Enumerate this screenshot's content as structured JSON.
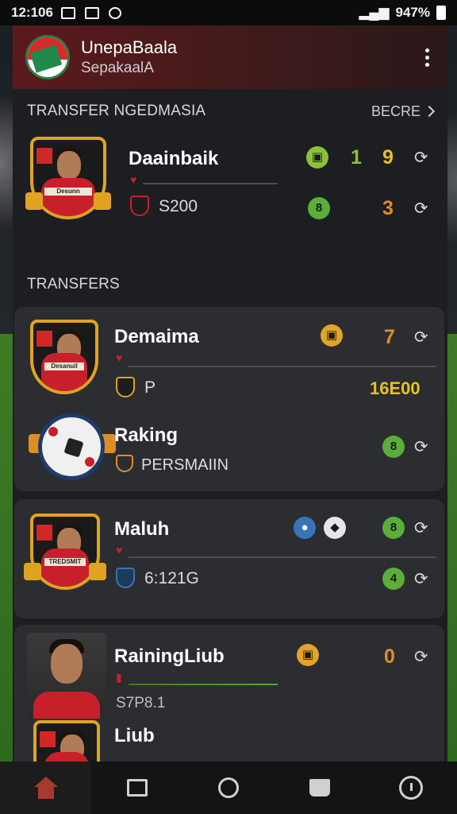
{
  "status_bar": {
    "time": "12:106",
    "battery": "947%"
  },
  "header": {
    "title": "UnepaBaala",
    "subtitle": "SepakaalA"
  },
  "featured": {
    "section_title": "TRANSFER NGEDMASIA",
    "more_label": "BECRE",
    "player": {
      "name": "Daainbaik",
      "sub_value": "S200",
      "score_a": "1",
      "score_b": "9",
      "score_c": "3",
      "crest_text": "Desunn"
    }
  },
  "transfers": {
    "section_title": "TRANSFERS",
    "cards": [
      {
        "rows": [
          {
            "name": "Demaima",
            "sub": "P",
            "value": "7",
            "amount": "16E00",
            "crest_text": "Desanuil"
          },
          {
            "name": "Raking",
            "sub": "PERSMAIIN",
            "value": "8"
          }
        ]
      },
      {
        "rows": [
          {
            "name": "Maluh",
            "sub": "6:121G",
            "value_a": "8",
            "value_b": "4",
            "crest_text": "TREDSMIT"
          }
        ]
      },
      {
        "rows": [
          {
            "name": "RainingLiub",
            "sub": "S7P8.1",
            "value": "0"
          },
          {
            "name": "Liub"
          }
        ]
      }
    ]
  },
  "colors": {
    "accent": "#5b1a1c",
    "gold": "#e0a321",
    "green": "#8bc13a",
    "orange": "#e28c24",
    "card": "#2b2d31"
  },
  "bottom_nav": [
    {
      "icon": "home-icon"
    },
    {
      "icon": "square-icon"
    },
    {
      "icon": "circle-icon"
    },
    {
      "icon": "folder-icon"
    },
    {
      "icon": "clock-icon"
    }
  ]
}
